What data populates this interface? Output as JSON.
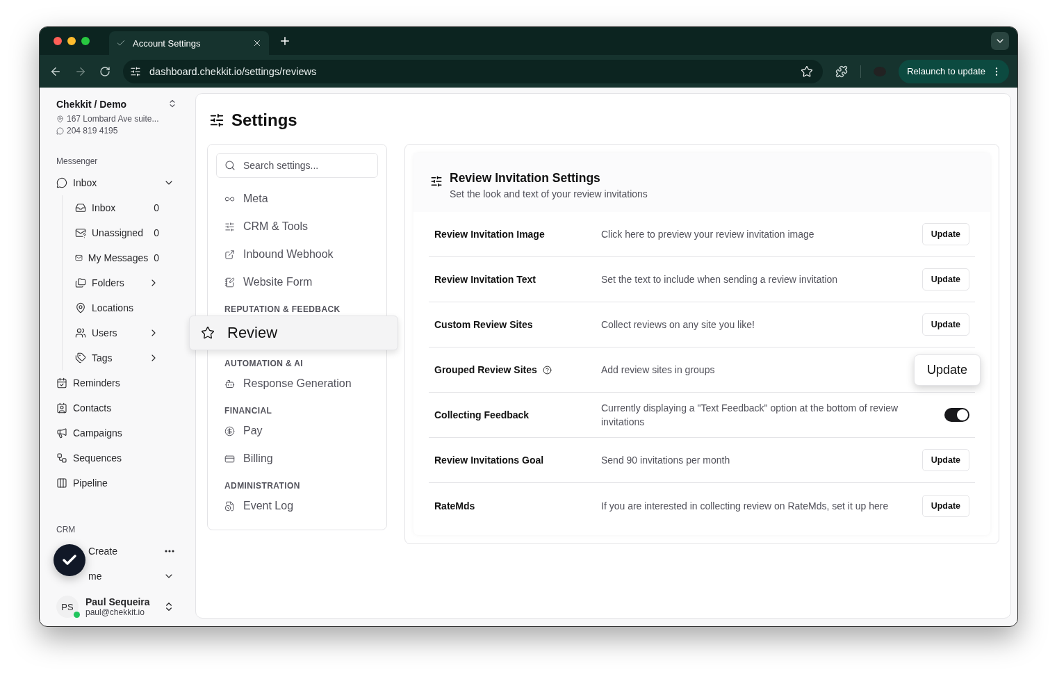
{
  "browser": {
    "tab_title": "Account Settings",
    "url": "dashboard.chekkit.io/settings/reviews",
    "relaunch_label": "Relaunch to update"
  },
  "sidebar": {
    "org_name": "Chekkit / Demo",
    "address": "167 Lombard Ave suite...",
    "phone": "204 819 4195",
    "sections": [
      {
        "heading": "Messenger",
        "items": [
          {
            "label": "Inbox",
            "kind": "group",
            "expanded": true,
            "children": [
              {
                "label": "Inbox",
                "kind": "link",
                "count": "0"
              },
              {
                "label": "Unassigned",
                "kind": "link",
                "count": "0"
              },
              {
                "label": "My Messages",
                "kind": "link",
                "count": "0"
              },
              {
                "label": "Folders",
                "kind": "group",
                "expanded": false
              },
              {
                "label": "Locations",
                "kind": "link"
              },
              {
                "label": "Users",
                "kind": "group",
                "expanded": false
              },
              {
                "label": "Tags",
                "kind": "group",
                "expanded": false
              }
            ]
          },
          {
            "label": "Reminders",
            "kind": "link"
          },
          {
            "label": "Contacts",
            "kind": "link"
          },
          {
            "label": "Campaigns",
            "kind": "link"
          },
          {
            "label": "Sequences",
            "kind": "link"
          },
          {
            "label": "Pipeline",
            "kind": "link"
          }
        ]
      },
      {
        "heading": "CRM",
        "items": [
          {
            "label": "Create",
            "kind": "action"
          },
          {
            "label": "me",
            "kind": "dropdown"
          }
        ]
      }
    ],
    "user": {
      "initials": "PS",
      "name": "Paul Sequeira",
      "email": "paul@chekkit.io",
      "online": true
    }
  },
  "page_title": "Settings",
  "settings_nav": {
    "search_placeholder": "Search settings...",
    "groups": [
      {
        "items": [
          {
            "label": "Meta",
            "selected": false
          },
          {
            "label": "CRM & Tools",
            "selected": false
          },
          {
            "label": "Inbound Webhook",
            "selected": false
          },
          {
            "label": "Website Form",
            "selected": false
          }
        ]
      },
      {
        "heading": "REPUTATION & FEEDBACK",
        "items": [
          {
            "label": "Review",
            "selected": true
          }
        ]
      },
      {
        "heading": "AUTOMATION & AI",
        "items": [
          {
            "label": "Response Generation",
            "selected": false
          }
        ]
      },
      {
        "heading": "FINANCIAL",
        "items": [
          {
            "label": "Pay",
            "selected": false
          },
          {
            "label": "Billing",
            "selected": false
          }
        ]
      },
      {
        "heading": "ADMINISTRATION",
        "items": [
          {
            "label": "Event Log",
            "selected": false
          }
        ]
      }
    ]
  },
  "panel": {
    "title": "Review Invitation Settings",
    "subtitle": "Set the look and text of your review invitations",
    "rows": [
      {
        "label": "Review Invitation Image",
        "help": false,
        "description": "Click here to preview your review invitation image",
        "kind": "button",
        "action_label": "Update",
        "hovered": false
      },
      {
        "label": "Review Invitation Text",
        "help": false,
        "description": "Set the text to include when sending a review invitation",
        "kind": "button",
        "action_label": "Update",
        "hovered": false
      },
      {
        "label": "Custom Review Sites",
        "help": false,
        "description": "Collect reviews on any site you like!",
        "kind": "button",
        "action_label": "Update",
        "hovered": false
      },
      {
        "label": "Grouped Review Sites",
        "help": true,
        "description": "Add review sites in groups",
        "kind": "button",
        "action_label": "Update",
        "hovered": true
      },
      {
        "label": "Collecting Feedback",
        "help": false,
        "description": "Currently displaying a \"Text Feedback\" option at the bottom of review invitations",
        "kind": "toggle",
        "on": true
      },
      {
        "label": "Review Invitations Goal",
        "help": false,
        "description": "Send 90 invitations per month",
        "kind": "button",
        "action_label": "Update",
        "hovered": false
      },
      {
        "label": "RateMds",
        "help": false,
        "description": "If you are interested in collecting review on RateMds, set it up here",
        "kind": "button",
        "action_label": "Update",
        "hovered": false
      }
    ]
  }
}
